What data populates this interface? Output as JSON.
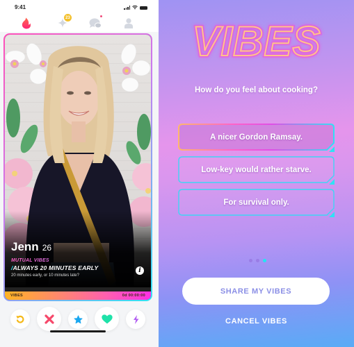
{
  "status_bar": {
    "time": "9:41"
  },
  "nav": {
    "items": [
      {
        "icon": "flame-icon",
        "label": "Discover",
        "active": true
      },
      {
        "icon": "sparkle-icon",
        "label": "Likes",
        "badge": "23"
      },
      {
        "icon": "chat-bubbles-icon",
        "label": "Messages",
        "has_dot": true
      },
      {
        "icon": "profile-icon",
        "label": "Profile"
      }
    ]
  },
  "profile": {
    "name": "Jenn",
    "age": "26",
    "mutual_label": "MUTUAL VIBES",
    "vibe_prefix": "/",
    "vibe_answer": "ALWAYS 20 MINUTES EARLY",
    "vibe_question": "20 minutes early, or 10 minutes late?",
    "info_icon": "info-icon"
  },
  "timer_bar": {
    "label": "VIBES",
    "countdown": "0d 00:00:00"
  },
  "actions": [
    {
      "name": "rewind",
      "icon": "rewind-icon",
      "color": "#f5b91a"
    },
    {
      "name": "nope",
      "icon": "x-icon",
      "color": "#f6486a"
    },
    {
      "name": "super-like",
      "icon": "star-icon",
      "color": "#1aa7f0"
    },
    {
      "name": "like",
      "icon": "heart-icon",
      "color": "#1fe2a9"
    },
    {
      "name": "boost",
      "icon": "lightning-icon",
      "color": "#b25ef2"
    }
  ],
  "vibes": {
    "title": "VIBES",
    "question": "How do you feel about cooking?",
    "options": [
      {
        "label": "A nicer Gordon Ramsay.",
        "selected": true
      },
      {
        "label": "Low-key would rather starve.",
        "selected": false
      },
      {
        "label": "For survival only.",
        "selected": false
      }
    ],
    "pagination": {
      "total": 3,
      "current": 3
    },
    "share_button": "SHARE MY VIBES",
    "cancel_button": "CANCEL VIBES"
  },
  "colors": {
    "tinder_brand": "#fd3a73",
    "neon_cyan": "#21e6f3",
    "neon_pink": "#ff4fb8",
    "share_text": "#8b8fe6"
  }
}
